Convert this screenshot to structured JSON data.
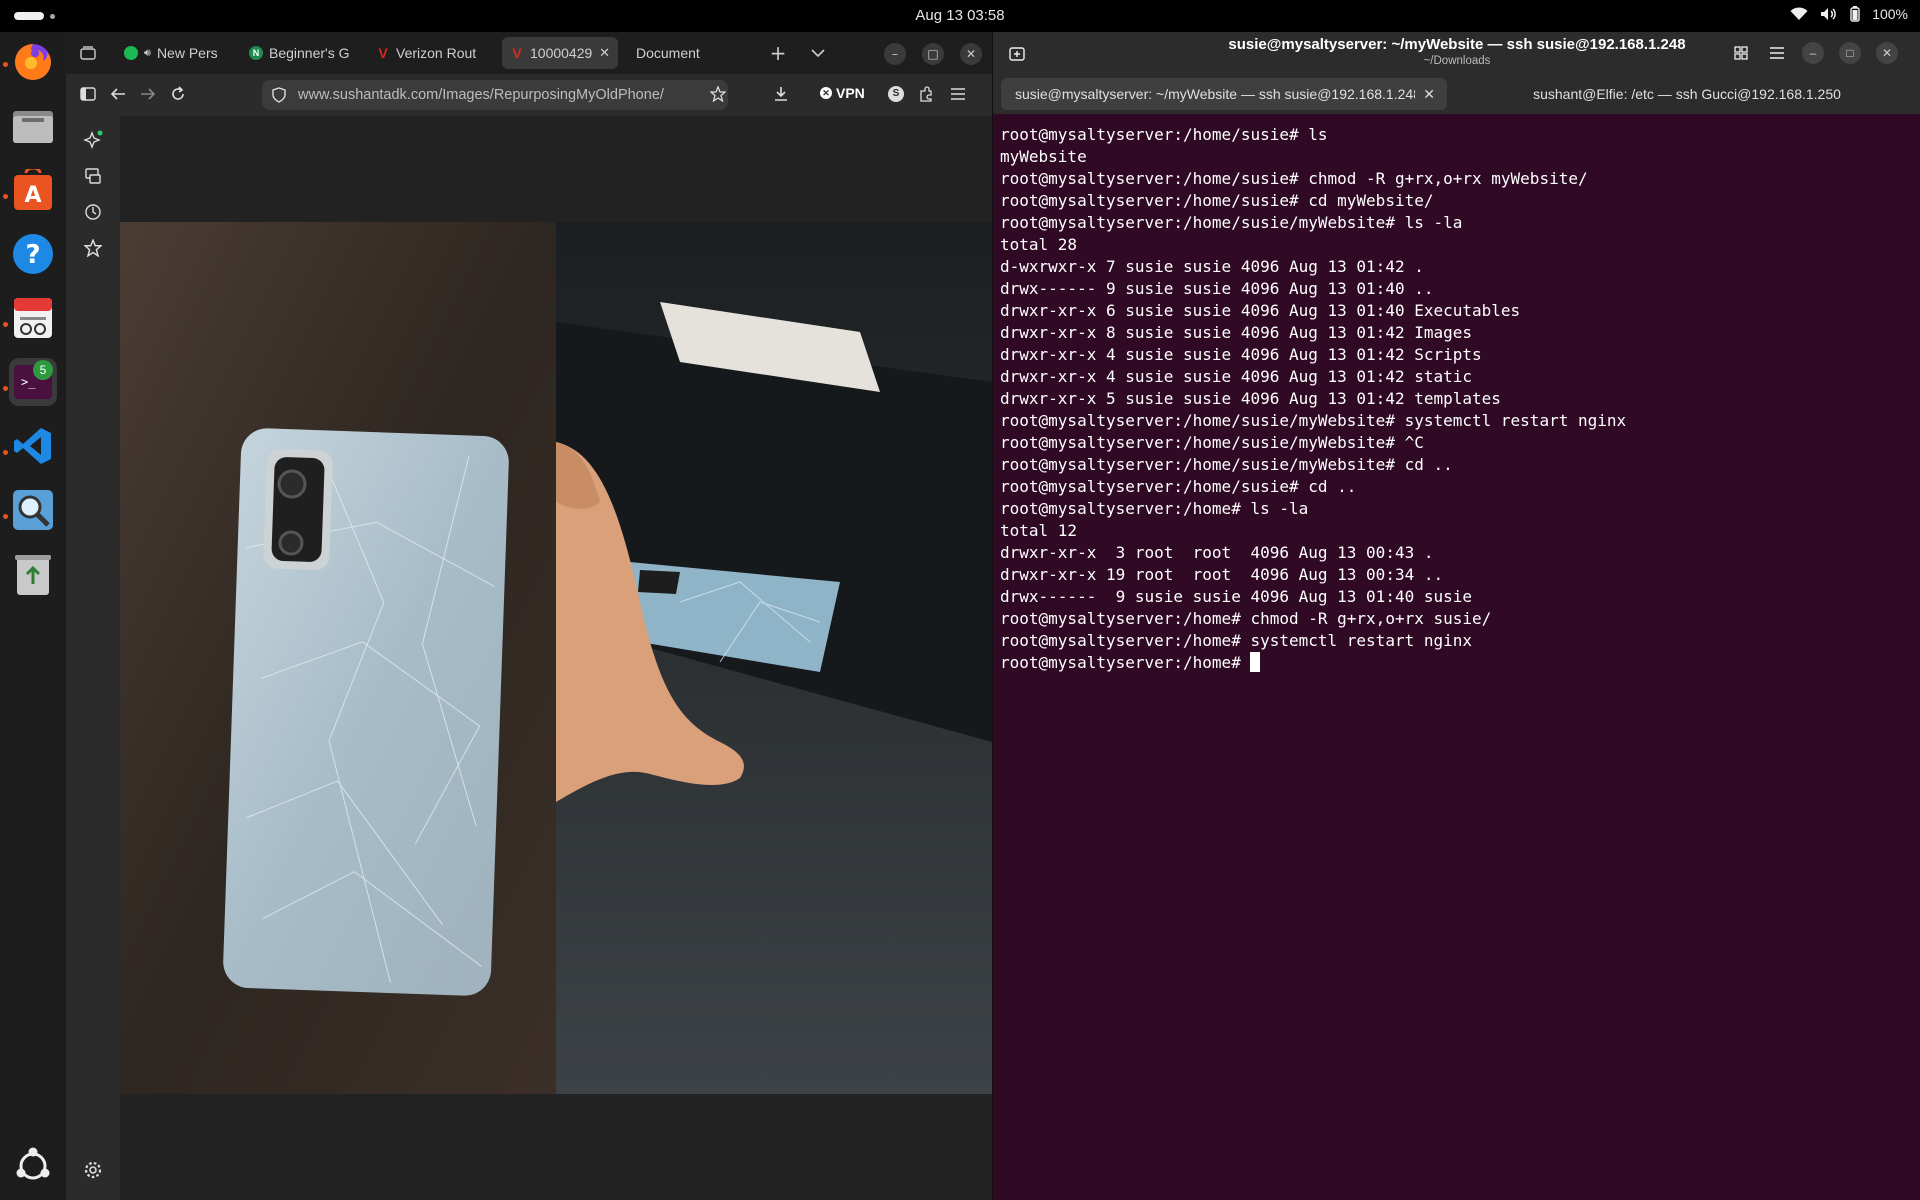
{
  "topbar": {
    "clock": "Aug 13  03:58",
    "battery": "100%"
  },
  "dock": {
    "terminal_badge": "5",
    "icons": [
      "firefox-icon",
      "files-icon",
      "app-center-icon",
      "help-icon",
      "text-editor-icon",
      "terminal-icon",
      "vscode-icon",
      "image-viewer-icon",
      "trash-icon",
      "show-apps-icon"
    ]
  },
  "browser": {
    "tabs": [
      {
        "label": "New Pers",
        "favicon": "spotify",
        "color": "#1db954"
      },
      {
        "label": "Beginner's G",
        "favicon": "N",
        "color": "#1f8b4c"
      },
      {
        "label": "Verizon Rout",
        "favicon": "V",
        "color": "#d52b1e"
      },
      {
        "label": "10000429",
        "favicon": "V",
        "color": "#d52b1e"
      },
      {
        "label": "Document",
        "favicon": "",
        "color": ""
      }
    ],
    "url": "www.sushantadk.com/Images/RepurposingMyOldPhone/",
    "vpn_label": "VPN"
  },
  "terminal": {
    "title": "susie@mysaltyserver: ~/myWebsite — ssh susie@192.168.1.248",
    "subtitle": "~/Downloads",
    "tabs": [
      "susie@mysaltyserver: ~/myWebsite — ssh susie@192.168.1.248",
      "sushant@Elfie: /etc — ssh Gucci@192.168.1.250"
    ],
    "lines": [
      "root@mysaltyserver:/home/susie# ls",
      "myWebsite",
      "root@mysaltyserver:/home/susie# chmod -R g+rx,o+rx myWebsite/",
      "root@mysaltyserver:/home/susie# cd myWebsite/",
      "root@mysaltyserver:/home/susie/myWebsite# ls -la",
      "total 28",
      "d-wxrwxr-x 7 susie susie 4096 Aug 13 01:42 .",
      "drwx------ 9 susie susie 4096 Aug 13 01:40 ..",
      "drwxr-xr-x 6 susie susie 4096 Aug 13 01:40 Executables",
      "drwxr-xr-x 8 susie susie 4096 Aug 13 01:42 Images",
      "drwxr-xr-x 4 susie susie 4096 Aug 13 01:42 Scripts",
      "drwxr-xr-x 4 susie susie 4096 Aug 13 01:42 static",
      "drwxr-xr-x 5 susie susie 4096 Aug 13 01:42 templates",
      "root@mysaltyserver:/home/susie/myWebsite# systemctl restart nginx",
      "root@mysaltyserver:/home/susie/myWebsite# ^C",
      "root@mysaltyserver:/home/susie/myWebsite# cd ..",
      "root@mysaltyserver:/home/susie# cd ..",
      "root@mysaltyserver:/home# ls -la",
      "total 12",
      "drwxr-xr-x  3 root  root  4096 Aug 13 00:43 .",
      "drwxr-xr-x 19 root  root  4096 Aug 13 00:34 ..",
      "drwx------  9 susie susie 4096 Aug 13 01:40 susie",
      "root@mysaltyserver:/home# chmod -R g+rx,o+rx susie/",
      "root@mysaltyserver:/home# systemctl restart nginx"
    ],
    "prompt": "root@mysaltyserver:/home# "
  }
}
